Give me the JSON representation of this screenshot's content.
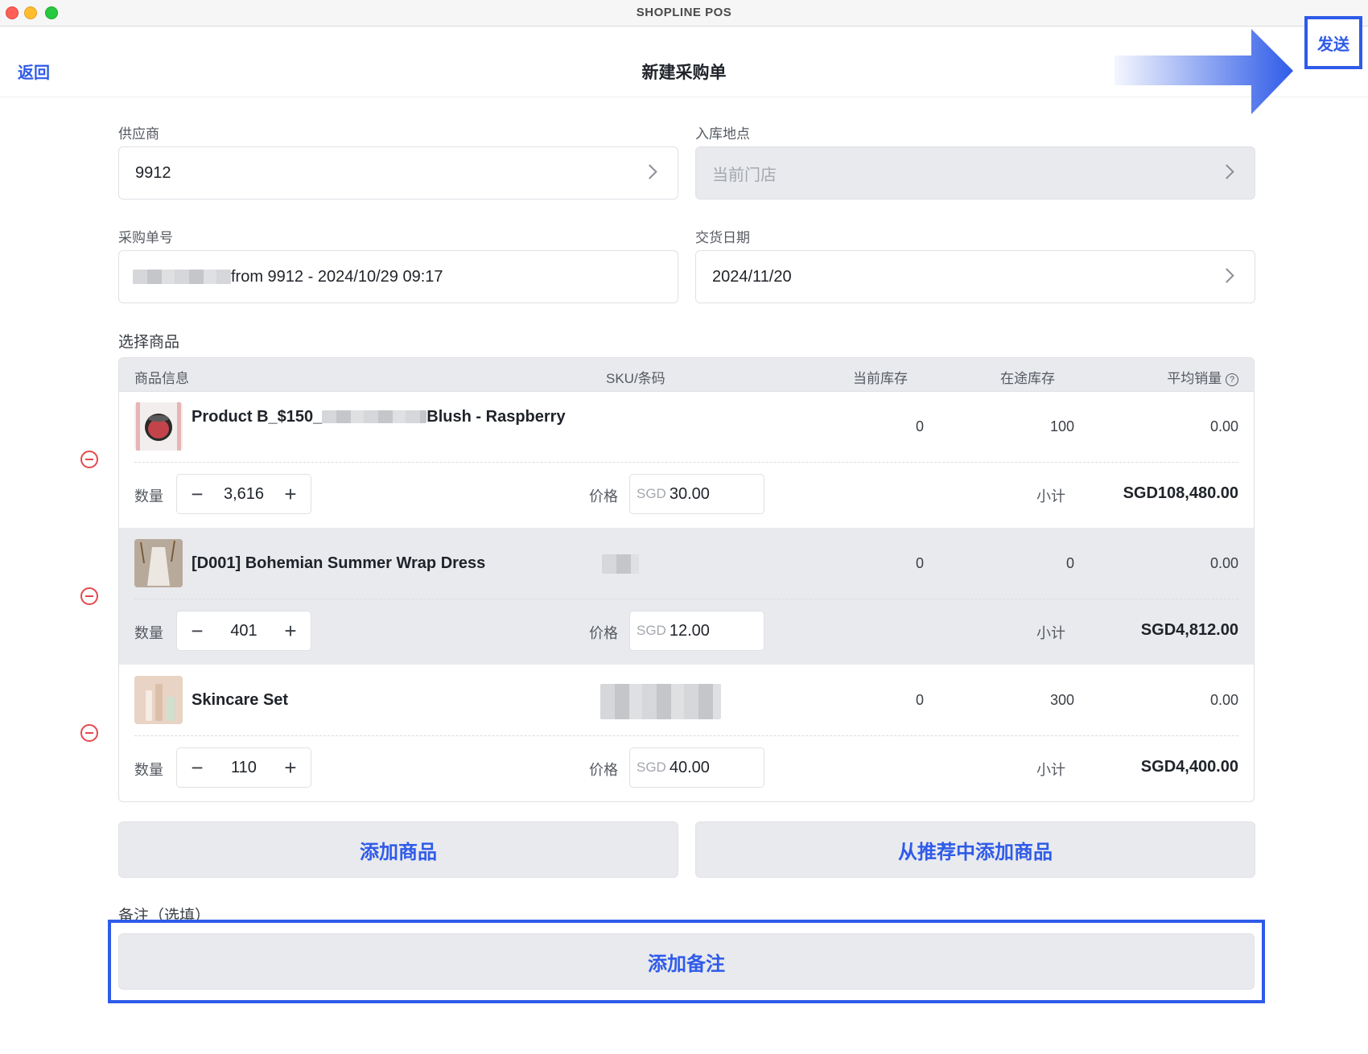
{
  "window": {
    "title": "SHOPLINE POS"
  },
  "header": {
    "back_label": "返回",
    "title": "新建采购单",
    "send_label": "发送"
  },
  "form": {
    "supplier": {
      "label": "供应商",
      "value": "9912"
    },
    "location": {
      "label": "入库地点",
      "placeholder": "当前门店"
    },
    "po_number": {
      "label": "采购单号",
      "value_suffix": "from 9912 - 2024/10/29 09:17"
    },
    "delivery_date": {
      "label": "交货日期",
      "value": "2024/11/20"
    }
  },
  "products": {
    "section_label": "选择商品",
    "columns": {
      "info": "商品信息",
      "sku": "SKU/条码",
      "current_stock": "当前库存",
      "in_transit": "在途库存",
      "avg_sales": "平均销量"
    },
    "row_labels": {
      "quantity": "数量",
      "price": "价格",
      "subtotal": "小计",
      "currency": "SGD"
    },
    "items": [
      {
        "name_prefix": "Product B_$150_",
        "name_suffix": "Blush - Raspberry",
        "current_stock": "0",
        "in_transit": "100",
        "avg_sales": "0.00",
        "quantity": "3,616",
        "price": "30.00",
        "subtotal": "SGD108,480.00"
      },
      {
        "name": "[D001] Bohemian Summer Wrap Dress",
        "current_stock": "0",
        "in_transit": "0",
        "avg_sales": "0.00",
        "quantity": "401",
        "price": "12.00",
        "subtotal": "SGD4,812.00"
      },
      {
        "name": "Skincare Set",
        "current_stock": "0",
        "in_transit": "300",
        "avg_sales": "0.00",
        "quantity": "110",
        "price": "40.00",
        "subtotal": "SGD4,400.00"
      }
    ]
  },
  "actions": {
    "add_product": "添加商品",
    "add_recommended": "从推荐中添加商品"
  },
  "notes": {
    "label": "备注（选填）",
    "add_label": "添加备注"
  },
  "colors": {
    "accent": "#2f5be8",
    "danger": "#e5484d",
    "panel": "#e9eaee"
  },
  "icons": {
    "chevron": "chevron-right-icon",
    "remove": "remove-circle-icon",
    "help": "help-circle-icon"
  }
}
